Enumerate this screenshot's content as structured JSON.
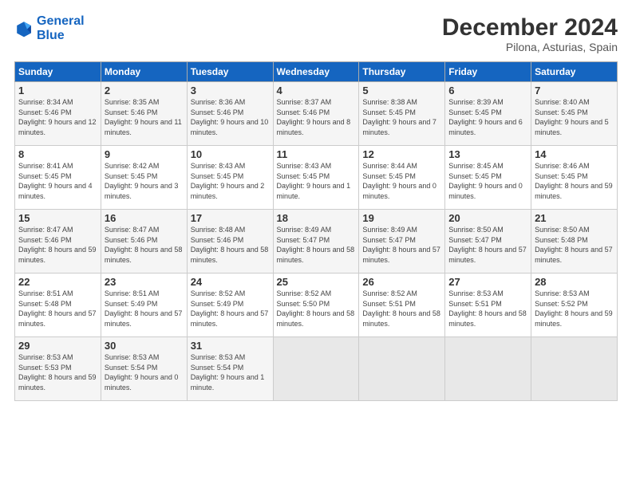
{
  "logo": {
    "line1": "General",
    "line2": "Blue"
  },
  "title": "December 2024",
  "location": "Pilona, Asturias, Spain",
  "header": {
    "days": [
      "Sunday",
      "Monday",
      "Tuesday",
      "Wednesday",
      "Thursday",
      "Friday",
      "Saturday"
    ]
  },
  "weeks": [
    [
      {
        "day": "1",
        "sunrise": "8:34 AM",
        "sunset": "5:46 PM",
        "daylight": "9 hours and 12 minutes."
      },
      {
        "day": "2",
        "sunrise": "8:35 AM",
        "sunset": "5:46 PM",
        "daylight": "9 hours and 11 minutes."
      },
      {
        "day": "3",
        "sunrise": "8:36 AM",
        "sunset": "5:46 PM",
        "daylight": "9 hours and 10 minutes."
      },
      {
        "day": "4",
        "sunrise": "8:37 AM",
        "sunset": "5:46 PM",
        "daylight": "9 hours and 8 minutes."
      },
      {
        "day": "5",
        "sunrise": "8:38 AM",
        "sunset": "5:45 PM",
        "daylight": "9 hours and 7 minutes."
      },
      {
        "day": "6",
        "sunrise": "8:39 AM",
        "sunset": "5:45 PM",
        "daylight": "9 hours and 6 minutes."
      },
      {
        "day": "7",
        "sunrise": "8:40 AM",
        "sunset": "5:45 PM",
        "daylight": "9 hours and 5 minutes."
      }
    ],
    [
      {
        "day": "8",
        "sunrise": "8:41 AM",
        "sunset": "5:45 PM",
        "daylight": "9 hours and 4 minutes."
      },
      {
        "day": "9",
        "sunrise": "8:42 AM",
        "sunset": "5:45 PM",
        "daylight": "9 hours and 3 minutes."
      },
      {
        "day": "10",
        "sunrise": "8:43 AM",
        "sunset": "5:45 PM",
        "daylight": "9 hours and 2 minutes."
      },
      {
        "day": "11",
        "sunrise": "8:43 AM",
        "sunset": "5:45 PM",
        "daylight": "9 hours and 1 minute."
      },
      {
        "day": "12",
        "sunrise": "8:44 AM",
        "sunset": "5:45 PM",
        "daylight": "9 hours and 0 minutes."
      },
      {
        "day": "13",
        "sunrise": "8:45 AM",
        "sunset": "5:45 PM",
        "daylight": "9 hours and 0 minutes."
      },
      {
        "day": "14",
        "sunrise": "8:46 AM",
        "sunset": "5:45 PM",
        "daylight": "8 hours and 59 minutes."
      }
    ],
    [
      {
        "day": "15",
        "sunrise": "8:47 AM",
        "sunset": "5:46 PM",
        "daylight": "8 hours and 59 minutes."
      },
      {
        "day": "16",
        "sunrise": "8:47 AM",
        "sunset": "5:46 PM",
        "daylight": "8 hours and 58 minutes."
      },
      {
        "day": "17",
        "sunrise": "8:48 AM",
        "sunset": "5:46 PM",
        "daylight": "8 hours and 58 minutes."
      },
      {
        "day": "18",
        "sunrise": "8:49 AM",
        "sunset": "5:47 PM",
        "daylight": "8 hours and 58 minutes."
      },
      {
        "day": "19",
        "sunrise": "8:49 AM",
        "sunset": "5:47 PM",
        "daylight": "8 hours and 57 minutes."
      },
      {
        "day": "20",
        "sunrise": "8:50 AM",
        "sunset": "5:47 PM",
        "daylight": "8 hours and 57 minutes."
      },
      {
        "day": "21",
        "sunrise": "8:50 AM",
        "sunset": "5:48 PM",
        "daylight": "8 hours and 57 minutes."
      }
    ],
    [
      {
        "day": "22",
        "sunrise": "8:51 AM",
        "sunset": "5:48 PM",
        "daylight": "8 hours and 57 minutes."
      },
      {
        "day": "23",
        "sunrise": "8:51 AM",
        "sunset": "5:49 PM",
        "daylight": "8 hours and 57 minutes."
      },
      {
        "day": "24",
        "sunrise": "8:52 AM",
        "sunset": "5:49 PM",
        "daylight": "8 hours and 57 minutes."
      },
      {
        "day": "25",
        "sunrise": "8:52 AM",
        "sunset": "5:50 PM",
        "daylight": "8 hours and 58 minutes."
      },
      {
        "day": "26",
        "sunrise": "8:52 AM",
        "sunset": "5:51 PM",
        "daylight": "8 hours and 58 minutes."
      },
      {
        "day": "27",
        "sunrise": "8:53 AM",
        "sunset": "5:51 PM",
        "daylight": "8 hours and 58 minutes."
      },
      {
        "day": "28",
        "sunrise": "8:53 AM",
        "sunset": "5:52 PM",
        "daylight": "8 hours and 59 minutes."
      }
    ],
    [
      {
        "day": "29",
        "sunrise": "8:53 AM",
        "sunset": "5:53 PM",
        "daylight": "8 hours and 59 minutes."
      },
      {
        "day": "30",
        "sunrise": "8:53 AM",
        "sunset": "5:54 PM",
        "daylight": "9 hours and 0 minutes."
      },
      {
        "day": "31",
        "sunrise": "8:53 AM",
        "sunset": "5:54 PM",
        "daylight": "9 hours and 1 minute."
      },
      null,
      null,
      null,
      null
    ]
  ]
}
